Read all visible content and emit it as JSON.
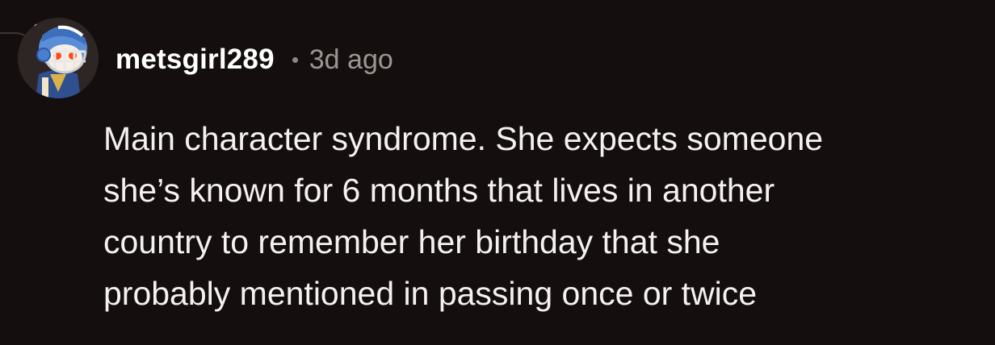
{
  "comment": {
    "username": "metsgirl289",
    "separator": "•",
    "timestamp": "3d ago",
    "avatar_icon": "snoo-avatar-football-helmet",
    "body_lines": [
      "Main character syndrome. She expects someone",
      "she’s known for 6 months that lives in another",
      "country to remember her birthday that she",
      "probably mentioned in passing once or twice"
    ]
  },
  "colors": {
    "background": "#140f0e",
    "username": "#ffffff",
    "timestamp": "#9c9692",
    "body_text": "#f4f2f1"
  }
}
